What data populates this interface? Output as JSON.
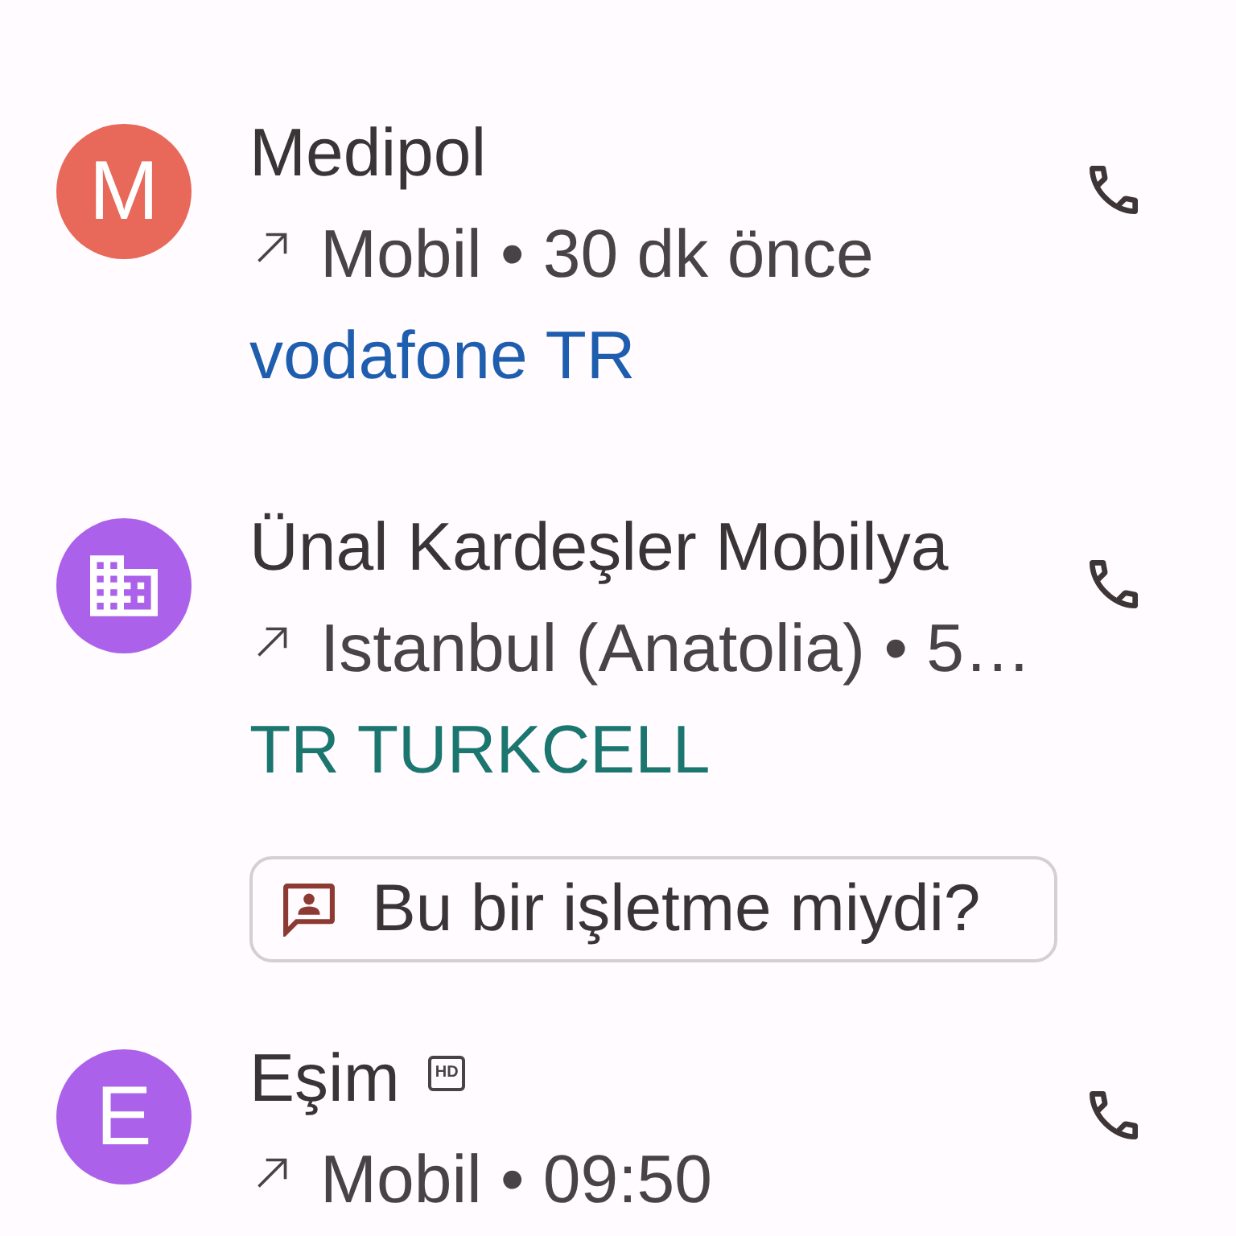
{
  "calls": [
    {
      "avatar": {
        "kind": "letter",
        "letter": "M",
        "color": "#e8685a"
      },
      "name": "Medipol",
      "outgoing": true,
      "details": "Mobil • 30 dk önce",
      "carrier": {
        "text": "vodafone TR",
        "color": "#1f5eae"
      }
    },
    {
      "avatar": {
        "kind": "business",
        "color": "#ab61e9"
      },
      "name": "Ünal Kardeşler Mobilya",
      "outgoing": true,
      "details": "Istanbul (Anatolia) • 5…",
      "carrier": {
        "text": "TR TURKCELL",
        "color": "#1b7670"
      },
      "prompt": {
        "label": "Bu bir işletme miydi?"
      }
    },
    {
      "avatar": {
        "kind": "letter",
        "letter": "E",
        "color": "#ab61e9"
      },
      "name": "Eşim",
      "badge": "HD",
      "outgoing": true,
      "details": "Mobil • 09:50"
    }
  ]
}
